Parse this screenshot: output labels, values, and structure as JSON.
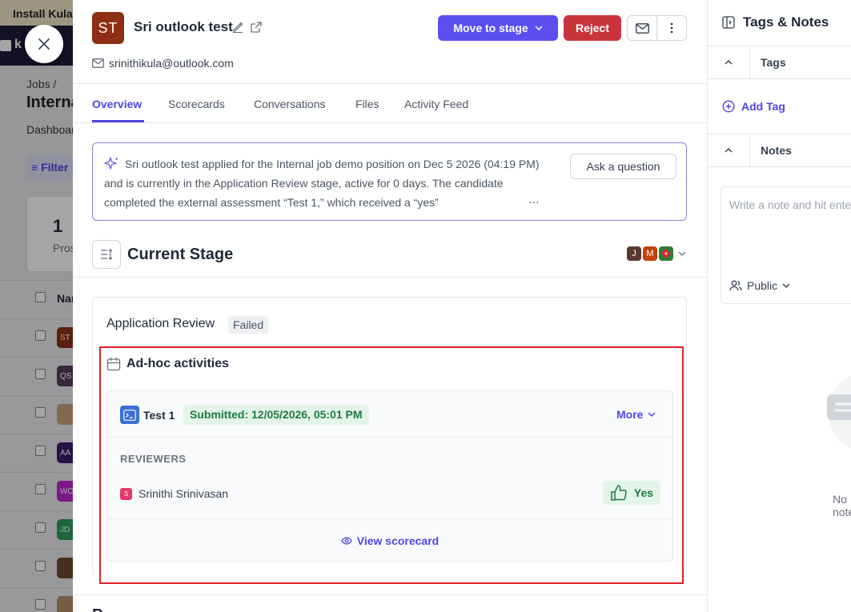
{
  "background": {
    "banner": "Install Kula",
    "brand": "k",
    "breadcrumb": "Jobs /",
    "job_title": "Internal job demo",
    "dashboard_tab": "Dashboard",
    "filter_label": "Filter",
    "stat_value": "1",
    "stat_label": "Prospects",
    "column_header": "Name",
    "rows": [
      {
        "initials": "ST",
        "color": "#8e2e14"
      },
      {
        "initials": "QS",
        "color": "#5b3a5e"
      },
      {
        "initials": "",
        "color": "#c9a27a"
      },
      {
        "initials": "AA",
        "color": "#3b1d6b"
      },
      {
        "initials": "WO",
        "color": "#c026d3"
      },
      {
        "initials": "JD",
        "color": "#2f9e5a"
      },
      {
        "initials": "",
        "color": "#6b4a2a"
      },
      {
        "initials": "",
        "color": "#b8906a"
      }
    ]
  },
  "candidate": {
    "initials": "ST",
    "name": "Sri outlook test",
    "email": "srinithikula@outlook.com"
  },
  "actions": {
    "move_to_stage": "Move to stage",
    "reject": "Reject"
  },
  "tabs": [
    "Overview",
    "Scorecards",
    "Conversations",
    "Files",
    "Activity Feed"
  ],
  "summary": {
    "text": "Sri outlook test applied for the Internal job demo position on Dec 5 2026 (04:19 PM) and is currently in the Application Review stage, active for 0 days. The candidate completed the external assessment “Test 1,” which received a “yes”",
    "ellipsis": "…",
    "ask_button": "Ask a question"
  },
  "current_stage": {
    "title": "Current Stage",
    "assignees": [
      {
        "initial": "J",
        "color": "#5b3a2e"
      },
      {
        "initial": "M",
        "color": "#c2410c"
      },
      {
        "initial": "",
        "color": "#2f7d32"
      }
    ]
  },
  "stage": {
    "name": "Application Review",
    "status": "Failed"
  },
  "adhoc": {
    "title": "Ad-hoc activities",
    "activity": {
      "name": "Test 1",
      "submitted": "Submitted: 12/05/2026, 05:01 PM",
      "more": "More",
      "reviewers_label": "REVIEWERS",
      "reviewer_initial": "S",
      "reviewer_name": "Srinithi Srinivasan",
      "verdict": "Yes",
      "view_scorecard": "View scorecard"
    }
  },
  "next_section_heading": "P",
  "side": {
    "title": "Tags & Notes",
    "tags_label": "Tags",
    "add_tag": "Add Tag",
    "notes_label": "Notes",
    "note_placeholder": "Write a note and hit enter",
    "visibility": "Public",
    "empty_text": "No notes"
  },
  "colors": {
    "primary": "#5b4ff0",
    "danger": "#c8353b",
    "success_bg": "#e3f5e8",
    "success_text": "#1f7a3f",
    "highlight": "#e0202a"
  }
}
